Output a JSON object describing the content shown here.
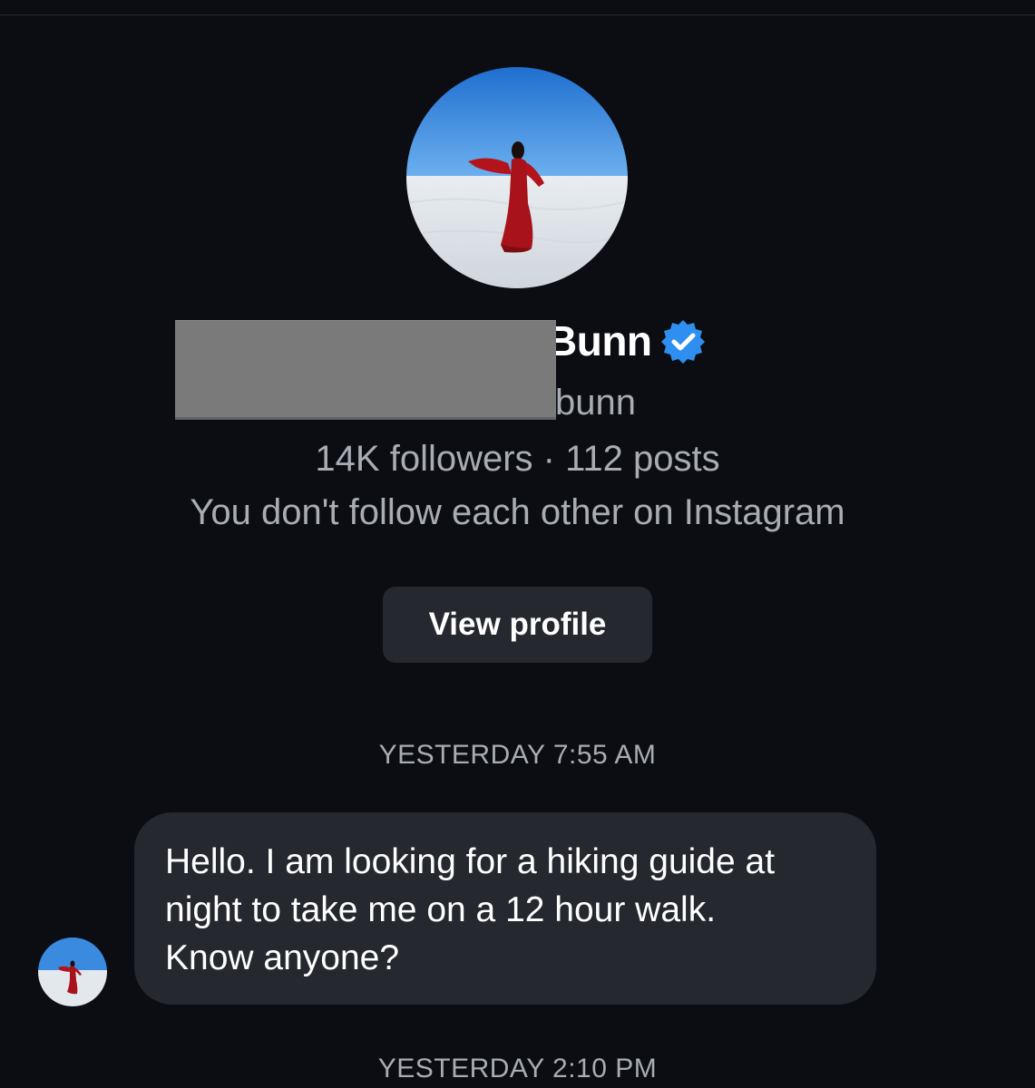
{
  "profile": {
    "display_name_visible": "Bunn",
    "username_visible": "bunn",
    "stats": "14K followers · 112 posts",
    "follow_status": "You don't follow each other on Instagram",
    "view_profile_label": "View profile",
    "verified": true
  },
  "messages": [
    {
      "timestamp": "YESTERDAY 7:55 AM",
      "text": "Hello. I am looking for a hiking guide at\nnight to take me on a 12 hour walk.\nKnow anyone?"
    }
  ],
  "next_timestamp": "YESTERDAY 2:10 PM",
  "colors": {
    "background": "#0b0d12",
    "bubble": "#25282e",
    "secondary_text": "#a8acb3",
    "verified_blue": "#2f8ff0"
  },
  "icons": {
    "verified": "verified-badge-icon",
    "profile_avatar": "avatar-photo",
    "sender_avatar": "avatar-photo"
  }
}
